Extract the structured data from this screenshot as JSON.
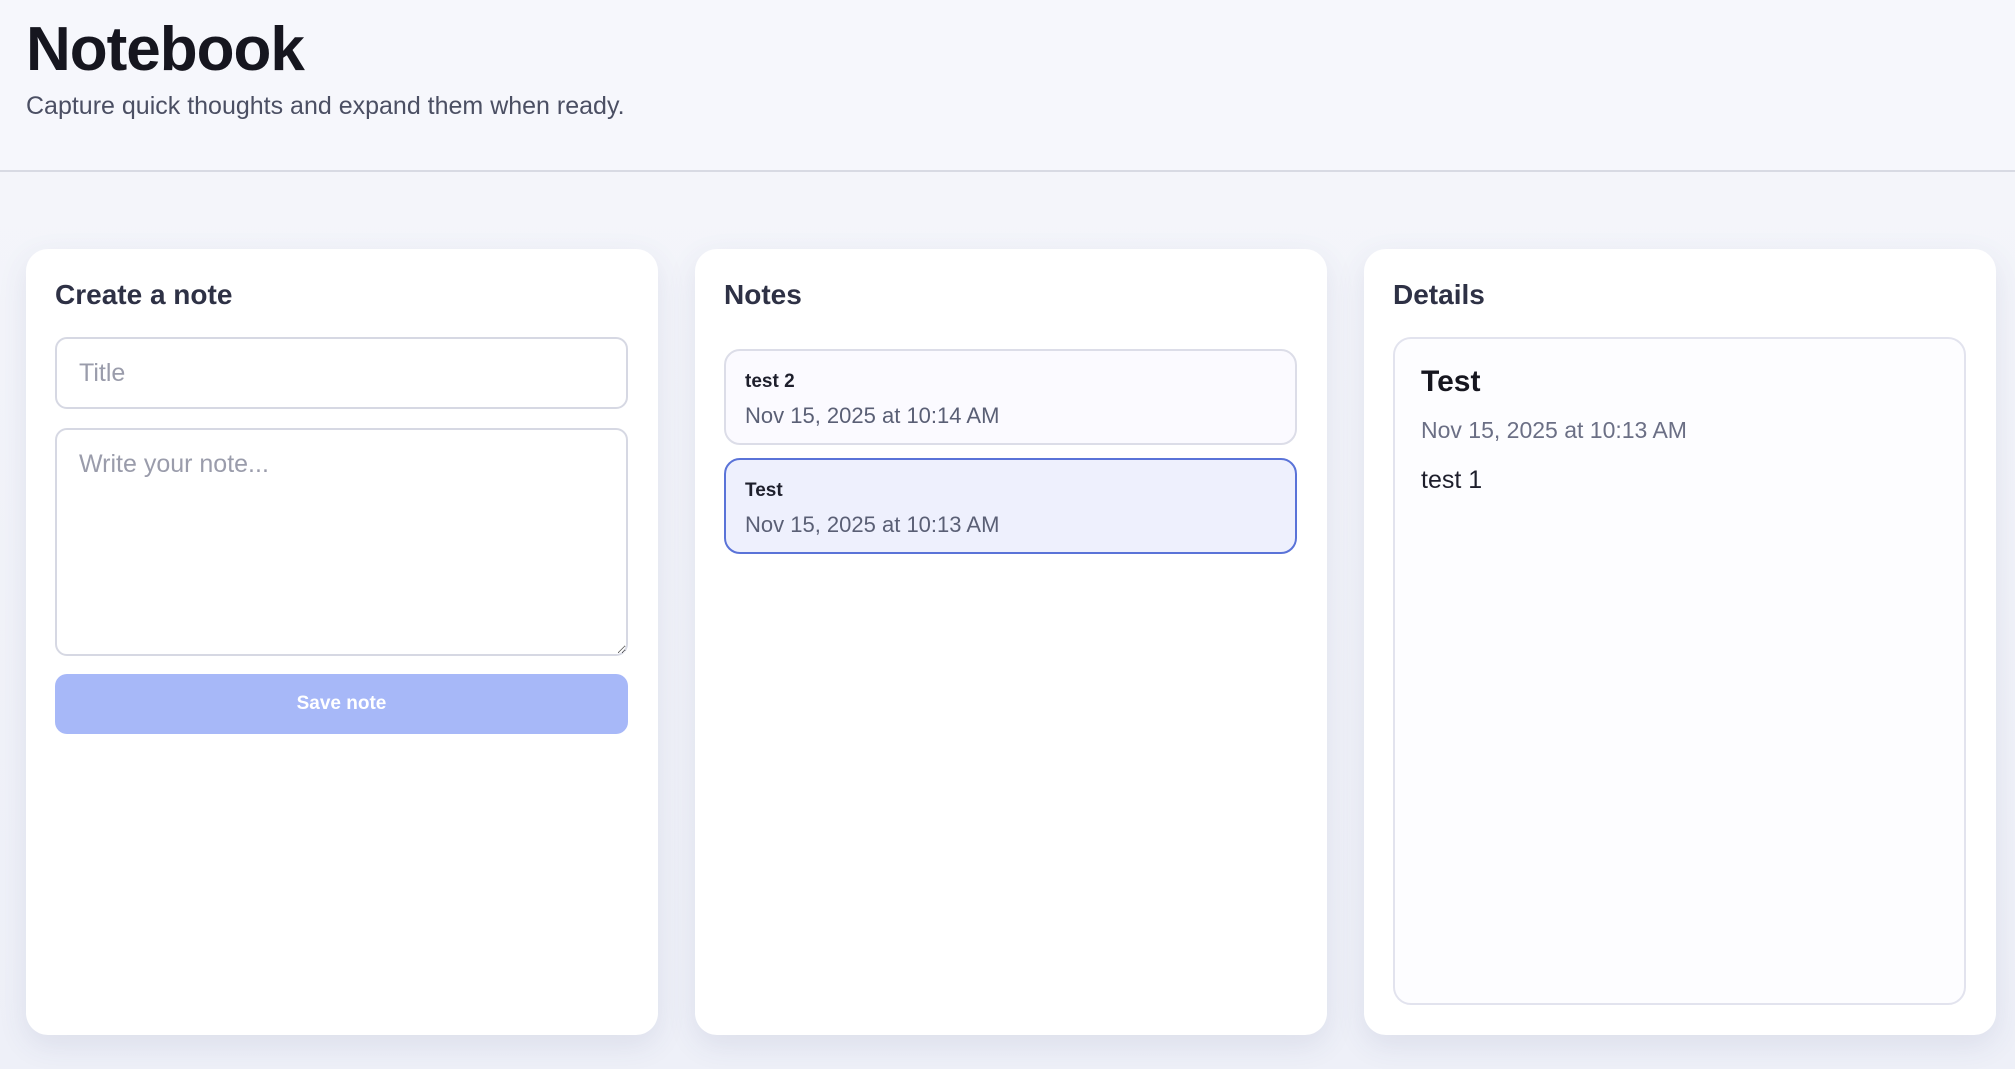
{
  "header": {
    "title": "Notebook",
    "subtitle": "Capture quick thoughts and expand them when ready."
  },
  "create": {
    "heading": "Create a note",
    "title_placeholder": "Title",
    "title_value": "",
    "body_placeholder": "Write your note...",
    "body_value": "",
    "save_label": "Save note"
  },
  "notes": {
    "heading": "Notes",
    "items": [
      {
        "title": "test 2",
        "date": "Nov 15, 2025 at 10:14 AM",
        "selected": false
      },
      {
        "title": "Test",
        "date": "Nov 15, 2025 at 10:13 AM",
        "selected": true
      }
    ]
  },
  "details": {
    "heading": "Details",
    "title": "Test",
    "date": "Nov 15, 2025 at 10:13 AM",
    "body": "test 1"
  },
  "colors": {
    "accent": "#5a73d8",
    "button": "#a7b8f8",
    "selected_bg": "#eef0fd"
  }
}
